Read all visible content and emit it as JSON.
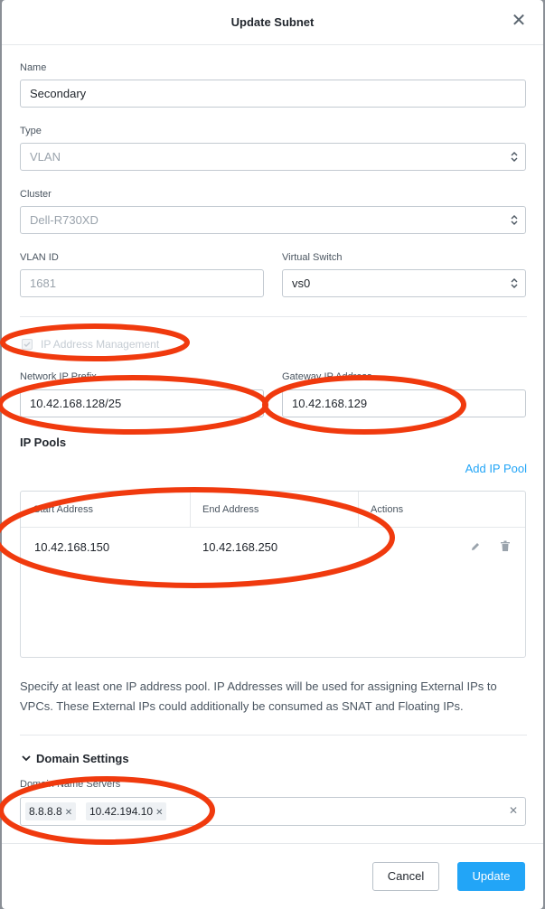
{
  "dialog": {
    "title": "Update Subnet",
    "close_icon": "close-icon"
  },
  "form": {
    "name": {
      "label": "Name",
      "value": "Secondary"
    },
    "type": {
      "label": "Type",
      "value": "VLAN"
    },
    "cluster": {
      "label": "Cluster",
      "value": "Dell-R730XD"
    },
    "vlan_id": {
      "label": "VLAN ID",
      "placeholder": "1681"
    },
    "virtual_switch": {
      "label": "Virtual Switch",
      "value": "vs0"
    },
    "ipam": {
      "label": "IP Address Management",
      "checked": true
    },
    "network_ip": {
      "label": "Network IP Prefix",
      "value": "10.42.168.128/25"
    },
    "gateway_ip": {
      "label": "Gateway IP Address",
      "value": "10.42.168.129"
    }
  },
  "ip_pools": {
    "title": "IP Pools",
    "add_label": "Add IP Pool",
    "columns": [
      "Start Address",
      "End Address",
      "Actions"
    ],
    "rows": [
      {
        "start": "10.42.168.150",
        "end": "10.42.168.250"
      }
    ],
    "help_text": "Specify at least one IP address pool. IP Addresses will be used for assigning External IPs to VPCs. These External IPs could additionally be consumed as SNAT and Floating IPs."
  },
  "domain_settings": {
    "title": "Domain Settings",
    "dns_label": "Domain Name Servers",
    "dns_servers": [
      "8.8.8.8",
      "10.42.194.10"
    ]
  },
  "footer": {
    "cancel_label": "Cancel",
    "update_label": "Update"
  },
  "colors": {
    "accent": "#22a5f7",
    "annotation": "#f03a0e"
  }
}
